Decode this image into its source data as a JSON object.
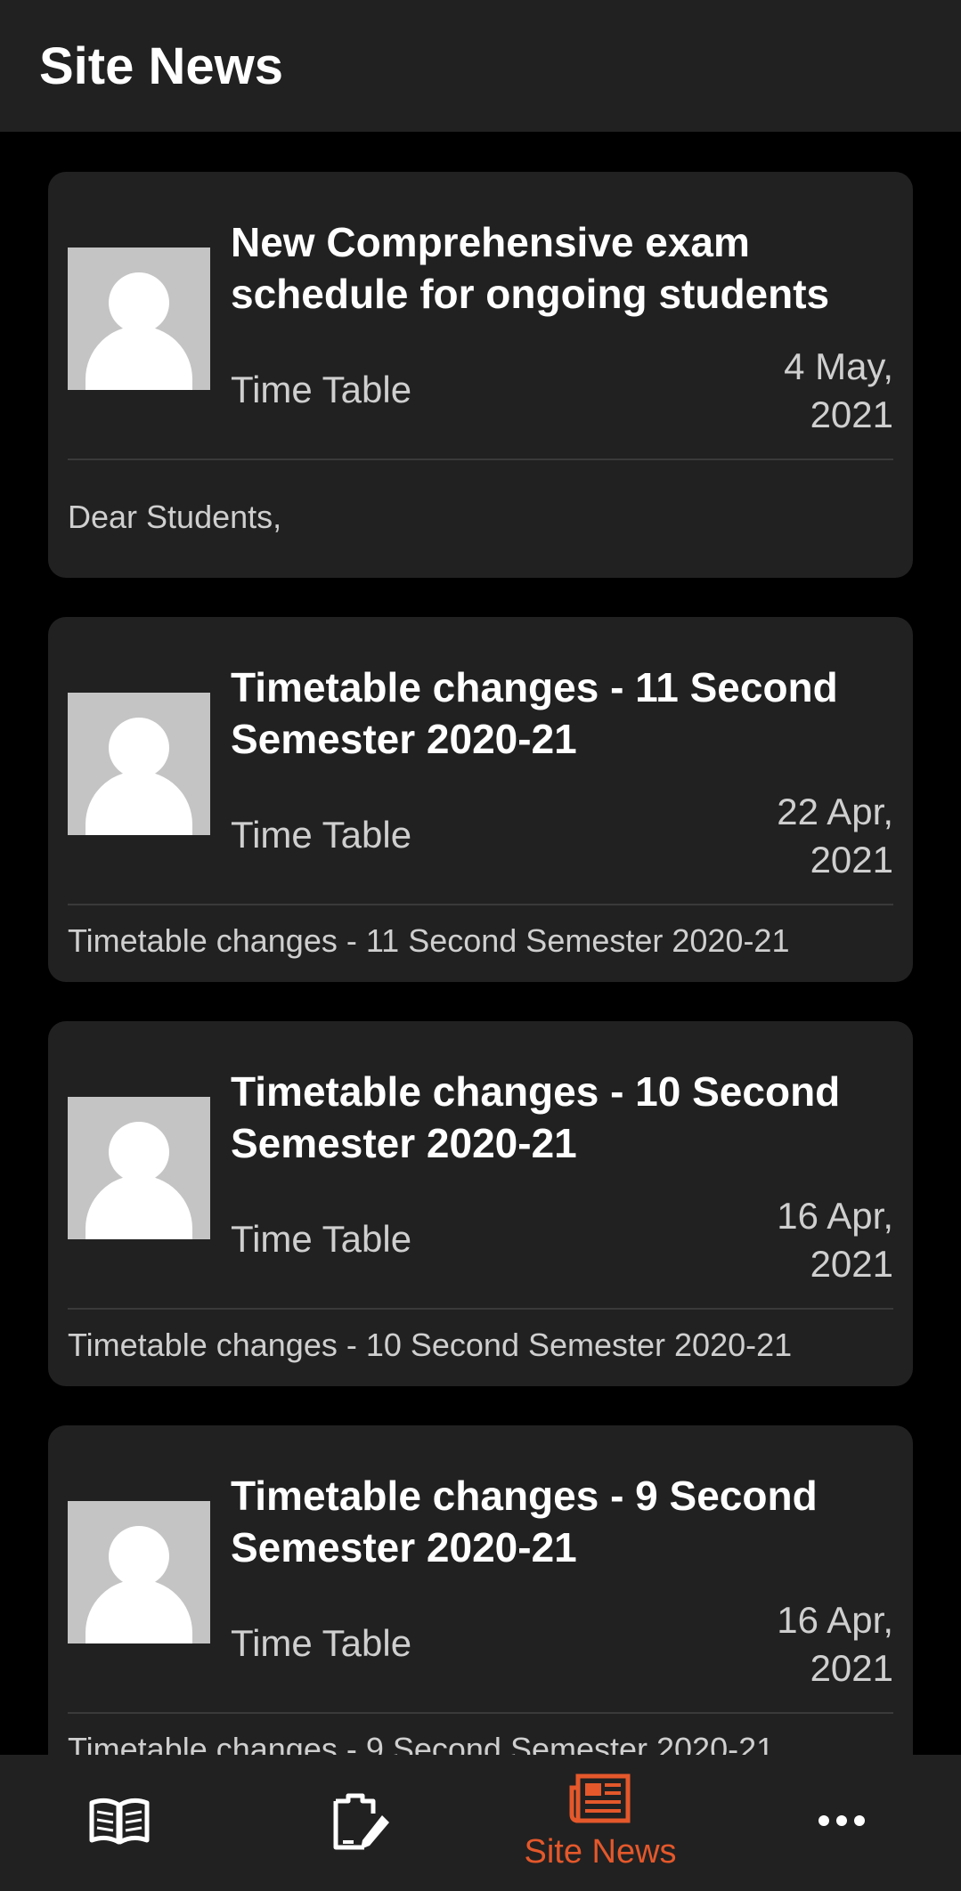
{
  "app_bar": {
    "title": "Site News"
  },
  "posts": [
    {
      "title": "New Comprehensive exam schedule for ongoing students",
      "category": "Time Table",
      "date_day": "4 May,",
      "date_year": "2021",
      "summary": "Dear Students,"
    },
    {
      "title": "Timetable changes - 11 Second Semester 2020-21",
      "category": "Time Table",
      "date_day": "22 Apr,",
      "date_year": "2021",
      "summary": "Timetable changes - 11 Second Semester 2020-21"
    },
    {
      "title": "Timetable changes - 10 Second Semester 2020-21",
      "category": "Time Table",
      "date_day": "16 Apr,",
      "date_year": "2021",
      "summary": "Timetable changes - 10 Second Semester 2020-21"
    },
    {
      "title": "Timetable changes - 9 Second Semester 2020-21",
      "category": "Time Table",
      "date_day": "16 Apr,",
      "date_year": "2021",
      "summary": "Timetable changes - 9 Second Semester 2020-21"
    }
  ],
  "bottom_nav": {
    "items": [
      {
        "icon": "book-icon",
        "label": ""
      },
      {
        "icon": "clipboard-edit-icon",
        "label": ""
      },
      {
        "icon": "newspaper-icon",
        "label": "Site News",
        "active": true
      },
      {
        "icon": "more-horizontal-icon",
        "label": ""
      }
    ],
    "active_color": "#e4582b",
    "inactive_color": "#ffffff"
  }
}
